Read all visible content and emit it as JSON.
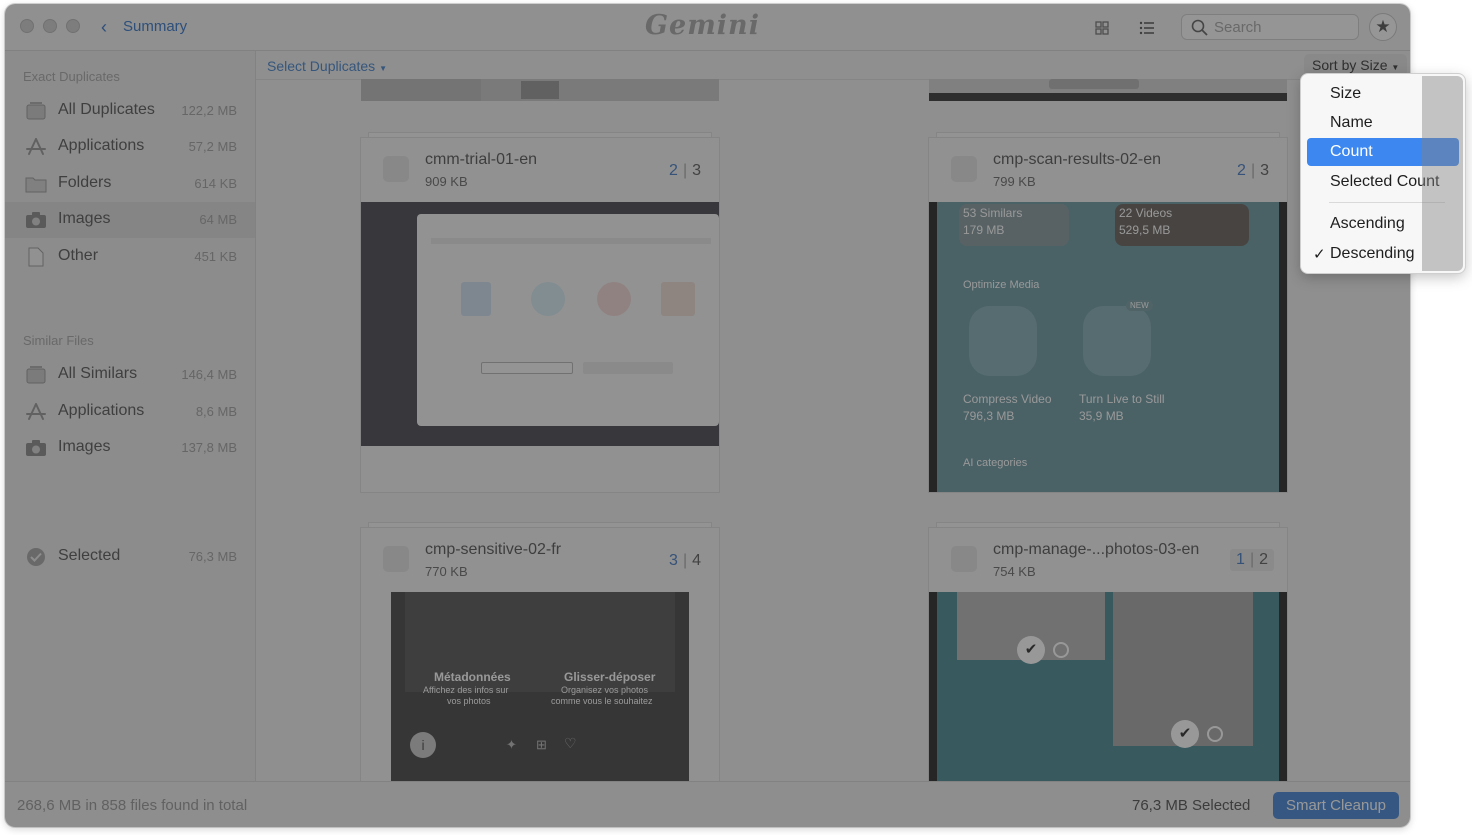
{
  "titlebar": {
    "back_label": "Summary",
    "app_logo": "Gemini",
    "search_placeholder": "Search",
    "icons": [
      "grid-view-icon",
      "list-view-icon",
      "search-icon",
      "star-icon"
    ]
  },
  "sidebar": {
    "exact_title": "Exact Duplicates",
    "exact_items": [
      {
        "label": "All Duplicates",
        "size": "122,2 MB",
        "icon": "stack-icon"
      },
      {
        "label": "Applications",
        "size": "57,2 MB",
        "icon": "app-store-icon"
      },
      {
        "label": "Folders",
        "size": "614 KB",
        "icon": "folder-icon"
      },
      {
        "label": "Images",
        "size": "64 MB",
        "icon": "camera-icon",
        "selected": true
      },
      {
        "label": "Other",
        "size": "451 KB",
        "icon": "document-icon"
      }
    ],
    "similar_title": "Similar Files",
    "similar_items": [
      {
        "label": "All Similars",
        "size": "146,4 MB",
        "icon": "stack-icon"
      },
      {
        "label": "Applications",
        "size": "8,6 MB",
        "icon": "app-store-icon"
      },
      {
        "label": "Images",
        "size": "137,8 MB",
        "icon": "camera-icon"
      }
    ],
    "selected_item": {
      "label": "Selected",
      "size": "76,3 MB",
      "icon": "checkmark-circle-icon"
    }
  },
  "toolbar": {
    "select_duplicates": "Select Duplicates",
    "sort_by": "Sort by Size"
  },
  "cards": [
    {
      "name": "cmm-trial-01-en",
      "size": "909 KB",
      "count_a": "2",
      "count_b": "3"
    },
    {
      "name": "cmp-scan-results-02-en",
      "size": "799 KB",
      "count_a": "2",
      "count_b": "3"
    },
    {
      "name": "cmp-sensitive-02-fr",
      "size": "770 KB",
      "count_a": "3",
      "count_b": "4"
    },
    {
      "name": "cmp-manage-...photos-03-en",
      "size": "754 KB",
      "count_a": "1",
      "count_b": "2"
    }
  ],
  "preview_text": {
    "scan": {
      "similars": "53 Similars",
      "similars_size": "179 MB",
      "videos": "22 Videos",
      "videos_size": "529,5 MB",
      "optimize_media": "Optimize Media",
      "new_badge": "NEW",
      "compress_video": "Compress Video",
      "compress_size": "796,3 MB",
      "turn_live": "Turn Live to Still",
      "turn_live_size": "35,9 MB",
      "ai_categories": "AI categories"
    },
    "sensitive": {
      "metadata_title": "Métadonnées",
      "metadata_desc_1": "Affichez des infos sur",
      "metadata_desc_2": "vos photos",
      "drag_title": "Glisser-déposer",
      "drag_desc_1": "Organisez vos photos",
      "drag_desc_2": "comme vous le souhaitez"
    }
  },
  "status": {
    "left": "268,6 MB in 858 files found in total",
    "selected": "76,3 MB Selected",
    "smart_cleanup": "Smart Cleanup"
  },
  "sort_menu": {
    "items": [
      "Size",
      "Name",
      "Count",
      "Selected Count"
    ],
    "highlighted": "Count",
    "order_items": [
      "Ascending",
      "Descending"
    ],
    "checked": "Descending",
    "check_mark": "✓"
  },
  "colors": {
    "accent": "#3c88f0",
    "link": "#3a78c8",
    "scan_preview_bg": "#6f9aa3",
    "manage_preview_bg": "#4f8d96"
  }
}
